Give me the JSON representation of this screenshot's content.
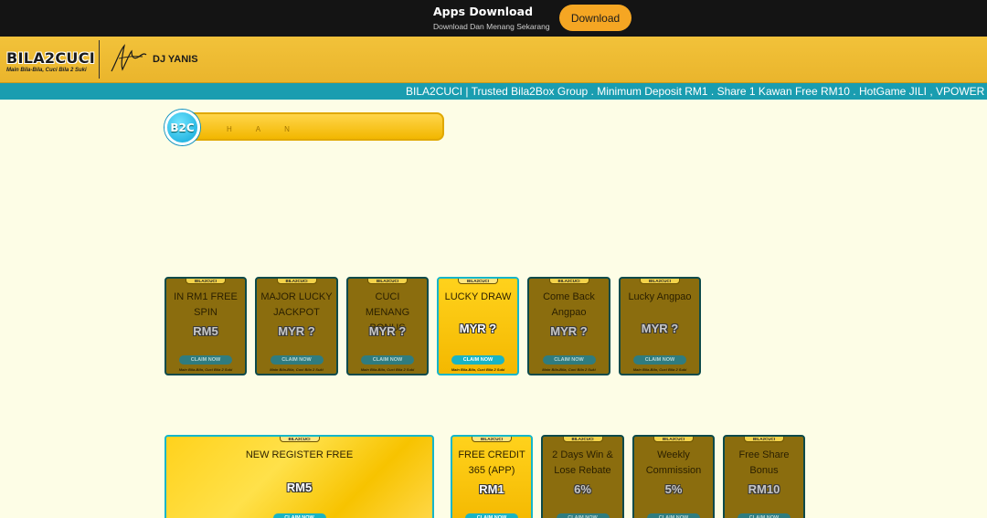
{
  "appbar": {
    "title": "Apps Download",
    "subtitle": "Download Dan Menang Sekarang",
    "download_label": "Download"
  },
  "header": {
    "logo_text": "BILA2CUCI",
    "logo_tagline": "Main Bila-Bila, Cuci Bila 2 Suki",
    "ambassador": "DJ YANIS"
  },
  "ticker": {
    "text": "BILA2CUCI | Trusted Bila2Box Group . Minimum Deposit RM1 . Share 1 Kawan Free RM10 . HotGame JILI , VPOWER , M"
  },
  "banner": {
    "badge": "B2C",
    "letters": "HAN"
  },
  "card_badge": "BILA2CUCI",
  "card_claim": "CLAIM NOW",
  "card_footer": "Main Bila-Bila, Cuci Bila 2 Suki",
  "promos_row1": [
    {
      "title": "IN RM1 FREE SPIN",
      "value": "RM5"
    },
    {
      "title": "MAJOR LUCKY JACKPOT",
      "value": "MYR ?"
    },
    {
      "title": "CUCI MENANG BONUS",
      "value": "MYR ?"
    },
    {
      "title": "LUCKY DRAW",
      "value": "MYR ?"
    },
    {
      "title": "Come Back Angpao",
      "value": "MYR ?"
    },
    {
      "title": "Lucky Angpao",
      "value": "MYR ?"
    }
  ],
  "promos_row2": [
    {
      "title": "NEW REGISTER FREE",
      "value": "RM5"
    },
    {
      "title": "FREE CREDIT 365 (APP)",
      "value": "RM1"
    },
    {
      "title": "2 Days Win & Lose Rebate",
      "value": "6%"
    },
    {
      "title": "Weekly Commission",
      "value": "5%"
    },
    {
      "title": "Free Share Bonus",
      "value": "RM10"
    }
  ]
}
